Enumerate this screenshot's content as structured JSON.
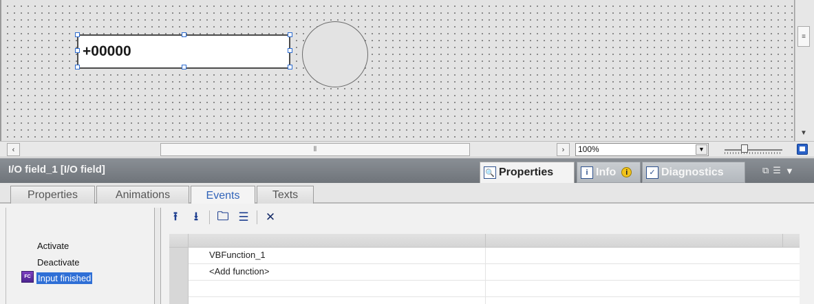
{
  "canvas": {
    "io_field_value": "+00000"
  },
  "zoom": {
    "level": "100%",
    "slider_level_fraction": 0.33
  },
  "inspector": {
    "title": "I/O field_1 [I/O field]",
    "tabs": [
      {
        "label": "Properties",
        "icon": "properties-icon",
        "active": true
      },
      {
        "label": "Info",
        "icon": "info-icon"
      },
      {
        "label": "Diagnostics",
        "icon": "diagnostics-icon"
      }
    ],
    "info_badge": "i"
  },
  "subtabs": [
    "Properties",
    "Animations",
    "Events",
    "Texts"
  ],
  "active_subtab": "Events",
  "events": {
    "items": [
      {
        "label": "Activate"
      },
      {
        "label": "Deactivate"
      },
      {
        "label": "Input finished",
        "selected": true
      }
    ]
  },
  "functions": {
    "rows": [
      "VBFunction_1",
      "<Add function>",
      "",
      ""
    ]
  },
  "colors": {
    "accent_blue": "#2f6fd6",
    "header_gray": "#7c8187",
    "active_tab_text": "#2f62b8"
  }
}
